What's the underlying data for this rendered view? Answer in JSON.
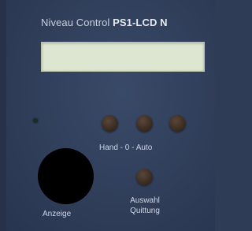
{
  "panel": {
    "brand": "Niveau Control",
    "model": "PS1-LCD N",
    "lcd_text": ""
  },
  "controls": {
    "mode_label": "Hand  -  0  -  Auto",
    "select_label_line1": "Auswahl",
    "select_label_line2": "Quittung",
    "display_label": "Anzeige"
  },
  "colors": {
    "panel": "#2f3c55",
    "lcd": "#dde6d1",
    "button": "#3a2c22",
    "knob": "#000000"
  }
}
